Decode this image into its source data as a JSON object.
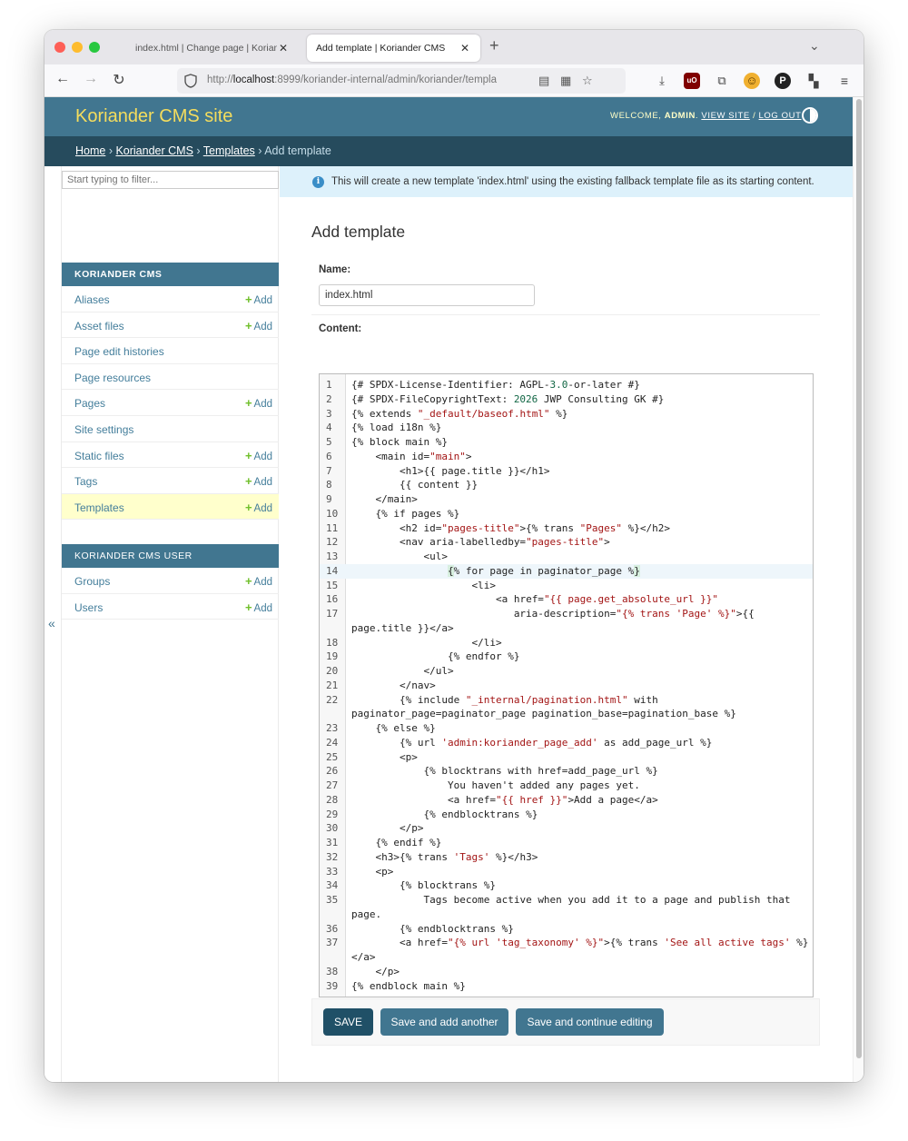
{
  "browser": {
    "tabs": [
      {
        "title": "index.html | Change page | Koriande"
      },
      {
        "title": "Add template | Koriander CMS"
      }
    ],
    "url_scheme": "http://",
    "url_host": "localhost",
    "url_path": ":8999/koriander-internal/admin/koriander/templa"
  },
  "header": {
    "site_title": "Koriander CMS site",
    "welcome": "WELCOME, ",
    "username": "ADMIN",
    "welcome_sep": ". ",
    "view_site": "VIEW SITE",
    "link_sep": " / ",
    "log_out": "LOG OUT"
  },
  "breadcrumbs": {
    "home": "Home",
    "app": "Koriander CMS",
    "model": "Templates",
    "sep": " › ",
    "current": "Add template"
  },
  "sidebar": {
    "filter_placeholder": "Start typing to filter...",
    "collapse_glyph": "«",
    "add_label": "Add",
    "modules": [
      {
        "caption": "Koriander CMS",
        "items": [
          {
            "label": "Aliases",
            "has_add": true
          },
          {
            "label": "Asset files",
            "has_add": true
          },
          {
            "label": "Page edit histories",
            "has_add": false
          },
          {
            "label": "Page resources",
            "has_add": false
          },
          {
            "label": "Pages",
            "has_add": true
          },
          {
            "label": "Site settings",
            "has_add": false
          },
          {
            "label": "Static files",
            "has_add": true
          },
          {
            "label": "Tags",
            "has_add": true
          },
          {
            "label": "Templates",
            "has_add": true,
            "selected": true
          }
        ]
      },
      {
        "caption": "Koriander CMS User",
        "items": [
          {
            "label": "Groups",
            "has_add": true
          },
          {
            "label": "Users",
            "has_add": true
          }
        ]
      }
    ]
  },
  "message": {
    "text": "This will create a new template 'index.html' using the existing fallback template file as its starting content."
  },
  "form": {
    "title": "Add template",
    "name_label": "Name:",
    "name_value": "index.html",
    "content_label": "Content:"
  },
  "code": {
    "active_line": 14,
    "lines": [
      "{# SPDX-License-Identifier: AGPL-3.0-or-later #}",
      "{# SPDX-FileCopyrightText: 2026 JWP Consulting GK #}",
      "{% extends \"_default/baseof.html\" %}",
      "{% load i18n %}",
      "{% block main %}",
      "    <main id=\"main\">",
      "        <h1>{{ page.title }}</h1>",
      "        {{ content }}",
      "    </main>",
      "    {% if pages %}",
      "        <h2 id=\"pages-title\">{% trans \"Pages\" %}</h2>",
      "        <nav aria-labelledby=\"pages-title\">",
      "            <ul>",
      "                {% for page in paginator_page %}",
      "                    <li>",
      "                        <a href=\"{{ page.get_absolute_url }}\"",
      "                           aria-description=\"{% trans 'Page' %}\">{{ page.title }}</a>",
      "                    </li>",
      "                {% endfor %}",
      "            </ul>",
      "        </nav>",
      "        {% include \"_internal/pagination.html\" with paginator_page=paginator_page pagination_base=pagination_base %}",
      "    {% else %}",
      "        {% url 'admin:koriander_page_add' as add_page_url %}",
      "        <p>",
      "            {% blocktrans with href=add_page_url %}",
      "                You haven't added any pages yet.",
      "                <a href=\"{{ href }}\">Add a page</a>",
      "            {% endblocktrans %}",
      "        </p>",
      "    {% endif %}",
      "    <h3>{% trans 'Tags' %}</h3>",
      "    <p>",
      "        {% blocktrans %}",
      "            Tags become active when you add it to a page and publish that page.",
      "        {% endblocktrans %}",
      "        <a href=\"{% url 'tag_taxonomy' %}\">{% trans 'See all active tags' %}</a>",
      "    </p>",
      "{% endblock main %}"
    ]
  },
  "buttons": {
    "save": "SAVE",
    "save_add_another": "Save and add another",
    "save_continue": "Save and continue editing"
  },
  "colors": {
    "header_bg": "#417690",
    "breadcrumb_bg": "#264b5d",
    "site_title": "#f5dd5d",
    "selected_row": "#ffffcc",
    "add_plus": "#70bf2b",
    "message_bg": "#ddf1fb",
    "save_button": "#205067"
  }
}
